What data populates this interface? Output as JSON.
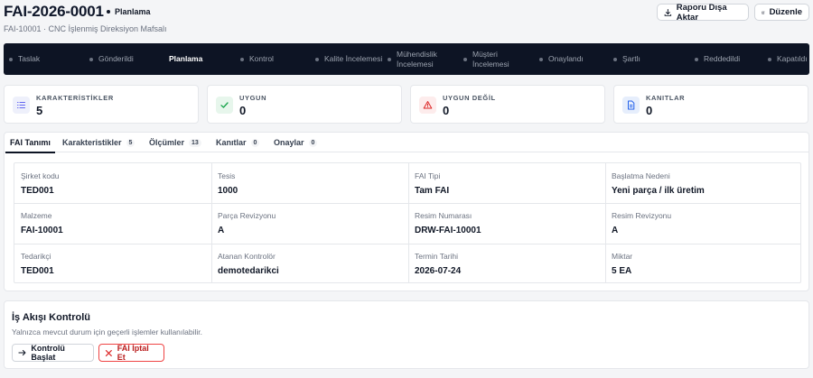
{
  "header": {
    "title": "FAI-2026-0001",
    "status": "Planlama",
    "subtitle": "FAI-10001 · CNC İşlenmiş Direksiyon Mafsalı",
    "export_label": "Raporu Dışa Aktar",
    "edit_label": "Düzenle"
  },
  "workflow_steps": [
    {
      "label": "Taslak"
    },
    {
      "label": "Gönderildi"
    },
    {
      "label": "Planlama"
    },
    {
      "label": "Kontrol"
    },
    {
      "label": "Kalite İncelemesi"
    },
    {
      "label": "Mühendislik İncelemesi"
    },
    {
      "label": "Müşteri İncelemesi"
    },
    {
      "label": "Onaylandı"
    },
    {
      "label": "Şartlı"
    },
    {
      "label": "Reddedildi"
    },
    {
      "label": "Kapatıldı"
    }
  ],
  "active_step": "Planlama",
  "summary": [
    {
      "label": "KARAKTERİSTİKLER",
      "value": "5",
      "icon": "list-icon",
      "color": "#6366f1",
      "bg": "#eef0fb"
    },
    {
      "label": "UYGUN",
      "value": "0",
      "icon": "check-icon",
      "color": "#16a34a",
      "bg": "#e7f6ec"
    },
    {
      "label": "UYGUN DEĞİL",
      "value": "0",
      "icon": "warning-icon",
      "color": "#dc2626",
      "bg": "#fdecec"
    },
    {
      "label": "KANITLAR",
      "value": "0",
      "icon": "document-icon",
      "color": "#2563eb",
      "bg": "#e6eefc"
    }
  ],
  "tabs": [
    {
      "label": "FAI Tanımı",
      "count": ""
    },
    {
      "label": "Karakteristikler",
      "count": "5"
    },
    {
      "label": "Ölçümler",
      "count": "13"
    },
    {
      "label": "Kanıtlar",
      "count": "0"
    },
    {
      "label": "Onaylar",
      "count": "0"
    }
  ],
  "fields": [
    {
      "label": "Şirket kodu",
      "value": "TED001"
    },
    {
      "label": "Tesis",
      "value": "1000"
    },
    {
      "label": "FAI Tipi",
      "value": "Tam FAI"
    },
    {
      "label": "Başlatma Nedeni",
      "value": "Yeni parça / ilk üretim"
    },
    {
      "label": "Malzeme",
      "value": "FAI-10001"
    },
    {
      "label": "Parça Revizyonu",
      "value": "A"
    },
    {
      "label": "Resim Numarası",
      "value": "DRW-FAI-10001"
    },
    {
      "label": "Resim Revizyonu",
      "value": "A"
    },
    {
      "label": "Tedarikçi",
      "value": "TED001"
    },
    {
      "label": "Atanan Kontrolör",
      "value": "demotedarikci"
    },
    {
      "label": "Termin Tarihi",
      "value": "2026-07-24"
    },
    {
      "label": "Miktar",
      "value": "5 EA"
    }
  ],
  "workflow_control": {
    "title": "İş Akışı Kontrolü",
    "description": "Yalnızca mevcut durum için geçerli işlemler kullanılabilir.",
    "start_label": "Kontrolü Başlat",
    "cancel_label": "FAI İptal Et"
  }
}
